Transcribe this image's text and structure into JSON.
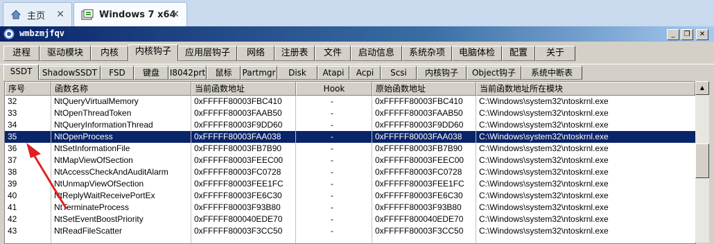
{
  "vm_tabs": [
    {
      "label": "主页",
      "icon": "home-icon",
      "close": "✕"
    },
    {
      "label": "Windows 7 x64",
      "icon": "vm-icon",
      "close": "✕"
    }
  ],
  "window": {
    "title": "wmbzmjfqv",
    "controls": {
      "minimize": "_",
      "restore": "❐",
      "close": "✕"
    }
  },
  "main_tabs": [
    "进程",
    "驱动模块",
    "内核",
    "内核钩子",
    "应用层钩子",
    "网络",
    "注册表",
    "文件",
    "启动信息",
    "系统杂项",
    "电脑体检",
    "配置",
    "关于"
  ],
  "active_main_tab": 3,
  "sub_tabs": [
    "SSDT",
    "ShadowSSDT",
    "FSD",
    "键盘",
    "I8042prt",
    "鼠标",
    "Partmgr",
    "Disk",
    "Atapi",
    "Acpi",
    "Scsi",
    "内核钩子",
    "Object钩子",
    "系统中断表"
  ],
  "active_sub_tab": 0,
  "columns": [
    "序号",
    "函数名称",
    "当前函数地址",
    "Hook",
    "原始函数地址",
    "当前函数地址所在模块"
  ],
  "rows": [
    {
      "id": "32",
      "name": "NtQueryVirtualMemory",
      "cur": "0xFFFFF80003FBC410",
      "hook": "-",
      "orig": "0xFFFFF80003FBC410",
      "module": "C:\\Windows\\system32\\ntoskrnl.exe"
    },
    {
      "id": "33",
      "name": "NtOpenThreadToken",
      "cur": "0xFFFFF80003FAAB50",
      "hook": "-",
      "orig": "0xFFFFF80003FAAB50",
      "module": "C:\\Windows\\system32\\ntoskrnl.exe"
    },
    {
      "id": "34",
      "name": "NtQueryInformationThread",
      "cur": "0xFFFFF80003F9DD60",
      "hook": "-",
      "orig": "0xFFFFF80003F9DD60",
      "module": "C:\\Windows\\system32\\ntoskrnl.exe"
    },
    {
      "id": "35",
      "name": "NtOpenProcess",
      "cur": "0xFFFFF80003FAA038",
      "hook": "-",
      "orig": "0xFFFFF80003FAA038",
      "module": "C:\\Windows\\system32\\ntoskrnl.exe"
    },
    {
      "id": "36",
      "name": "NtSetInformationFile",
      "cur": "0xFFFFF80003FB7B90",
      "hook": "-",
      "orig": "0xFFFFF80003FB7B90",
      "module": "C:\\Windows\\system32\\ntoskrnl.exe"
    },
    {
      "id": "37",
      "name": "NtMapViewOfSection",
      "cur": "0xFFFFF80003FEEC00",
      "hook": "-",
      "orig": "0xFFFFF80003FEEC00",
      "module": "C:\\Windows\\system32\\ntoskrnl.exe"
    },
    {
      "id": "38",
      "name": "NtAccessCheckAndAuditAlarm",
      "cur": "0xFFFFF80003FC0728",
      "hook": "-",
      "orig": "0xFFFFF80003FC0728",
      "module": "C:\\Windows\\system32\\ntoskrnl.exe"
    },
    {
      "id": "39",
      "name": "NtUnmapViewOfSection",
      "cur": "0xFFFFF80003FEE1FC",
      "hook": "-",
      "orig": "0xFFFFF80003FEE1FC",
      "module": "C:\\Windows\\system32\\ntoskrnl.exe"
    },
    {
      "id": "40",
      "name": "NtReplyWaitReceivePortEx",
      "cur": "0xFFFFF80003FE6C30",
      "hook": "-",
      "orig": "0xFFFFF80003FE6C30",
      "module": "C:\\Windows\\system32\\ntoskrnl.exe"
    },
    {
      "id": "41",
      "name": "NtTerminateProcess",
      "cur": "0xFFFFF80003F93B80",
      "hook": "-",
      "orig": "0xFFFFF80003F93B80",
      "module": "C:\\Windows\\system32\\ntoskrnl.exe"
    },
    {
      "id": "42",
      "name": "NtSetEventBoostPriority",
      "cur": "0xFFFFF800040EDE70",
      "hook": "-",
      "orig": "0xFFFFF800040EDE70",
      "module": "C:\\Windows\\system32\\ntoskrnl.exe"
    },
    {
      "id": "43",
      "name": "NtReadFileScatter",
      "cur": "0xFFFFF80003F3CC50",
      "hook": "-",
      "orig": "0xFFFFF80003F3CC50",
      "module": "C:\\Windows\\system32\\ntoskrnl.exe"
    }
  ],
  "selected_row": 3,
  "annotation": {
    "color": "#e02020"
  }
}
